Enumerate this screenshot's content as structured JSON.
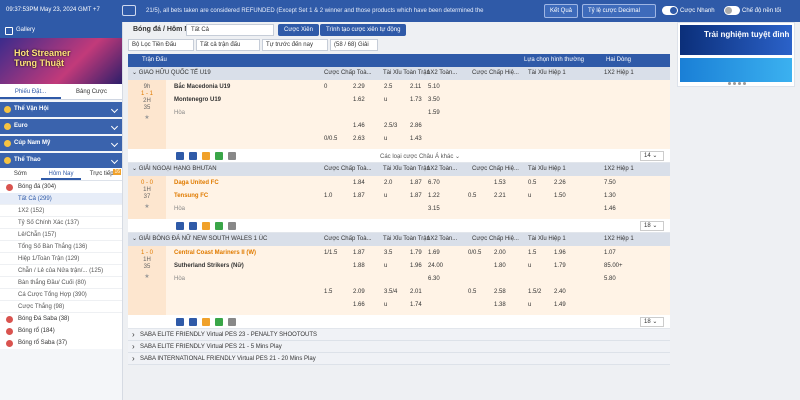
{
  "topbar": {
    "time": "09:37:53PM May 23, 2024 GMT +7",
    "ticker": "21/5), all bets taken are considered REFUNDED (Except Set 1 & 2 winner and those products which have been determined the",
    "result_btn": "Kết Quả",
    "odds_type": "Tỷ lệ cược Decimal",
    "quick_bet": "Cược Nhanh",
    "odds_only": "Chế độ nền tối"
  },
  "sidebar": {
    "gallery": "Gallery",
    "banner_text": "Hot Streamer Tưng Thuật",
    "tabs": [
      "Phiếu Đặt...",
      "Bảng Cược"
    ],
    "categories": [
      "Thể Vận Hội",
      "Euro",
      "Cúp Nam Mỹ",
      "Thể Thao"
    ],
    "subtabs": [
      "Sớm",
      "Hôm Nay",
      "Trực tiếp"
    ],
    "live_count": "16",
    "sports": [
      {
        "label": "Bóng đá",
        "count": "(304)"
      },
      {
        "label": "Tất Cả",
        "count": "(299)"
      },
      {
        "label": "1X2",
        "count": "(152)"
      },
      {
        "label": "Tỷ Số Chính Xác",
        "count": "(137)"
      },
      {
        "label": "Lẻ/Chẵn",
        "count": "(157)"
      },
      {
        "label": "Tổng Số Bàn Thắng",
        "count": "(136)"
      },
      {
        "label": "Hiệp 1/Toàn Trận",
        "count": "(129)"
      },
      {
        "label": "Chẵn / Lẻ của Nửa trận/...",
        "count": "(125)"
      },
      {
        "label": "Bàn thắng Đầu/ Cuối",
        "count": "(80)"
      },
      {
        "label": "Cá Cược Tổng Hợp",
        "count": "(390)"
      },
      {
        "label": "Cược Thắng",
        "count": "(98)"
      },
      {
        "label": "Bóng Đá Saba",
        "count": "(38)"
      },
      {
        "label": "Bóng rổ",
        "count": "(184)"
      },
      {
        "label": "Bóng rổ Saba",
        "count": "(37)"
      }
    ]
  },
  "main": {
    "title": "Bóng đá / Hôm Nay",
    "select_all": "Tất Cả",
    "bet_btn": "Cược Xiên",
    "create_btn": "Trình tạo cược xiên tự động",
    "filters": [
      "Bộ Lọc Tiền Đấu",
      "Tất cả trận đấu",
      "Tự trước đến nay",
      "(58 / 68) Giải"
    ],
    "col_headers": [
      "Cược Chấp Toà...",
      "Tài Xỉu Toàn Trận",
      "1X2 Toàn...",
      "Cược Chấp Hiệ...",
      "Tài Xỉu Hiệp 1",
      "1X2 Hiệp 1"
    ],
    "top_header": {
      "label": "Trận Đấu",
      "sort": "Lựa chọn hình thường",
      "view": "Hai Dòng"
    },
    "leagues": [
      {
        "name": "GIAO HỮU QUỐC TẾ U19",
        "time": "9h",
        "score": "1 - 1",
        "period": "2H",
        "minute": "35",
        "home": "Bắc Macedonia U19",
        "away": "Montenegro U19",
        "draw": "Hòa",
        "rows": [
          [
            "0",
            "2.29",
            "2.5",
            "2.11",
            "5.10",
            "",
            "",
            "",
            "",
            "",
            ""
          ],
          [
            "",
            "1.62",
            "u",
            "1.73",
            "3.50",
            "",
            "",
            "",
            "",
            "",
            ""
          ],
          [
            "",
            "",
            "",
            "",
            "1.59",
            "",
            "",
            "",
            "",
            "",
            ""
          ],
          [
            "",
            "1.46",
            "2.5/3",
            "2.86",
            "",
            "",
            "",
            "",
            "",
            "",
            ""
          ],
          [
            "0/0.5",
            "2.63",
            "u",
            "1.43",
            "",
            "",
            "",
            "",
            "",
            "",
            ""
          ]
        ],
        "more": "Các loại cược Châu Á khác",
        "page": "14"
      },
      {
        "name": "GIẢI NGOẠI HẠNG BHUTAN",
        "score": "0 - 0",
        "period": "1H",
        "minute": "37",
        "home": "Daga United FC",
        "away": "Tensung FC",
        "draw": "Hòa",
        "rows": [
          [
            "",
            "1.84",
            "2.0",
            "1.87",
            "6.70",
            "",
            "1.53",
            "0.5",
            "2.26",
            "7.50"
          ],
          [
            "1.0",
            "1.87",
            "u",
            "1.87",
            "1.22",
            "0.5",
            "2.21",
            "u",
            "1.50",
            "1.30"
          ],
          [
            "",
            "",
            "",
            "",
            "3.15",
            "",
            "",
            "",
            "",
            "1.46"
          ]
        ],
        "page": "18"
      },
      {
        "name": "GIẢI BÓNG ĐÁ NỮ NEW SOUTH WALES 1 ÚC",
        "score": "1 - 0",
        "period": "1H",
        "minute": "35",
        "home": "Central Coast Mariners II (W)",
        "away": "Sutherland Strikers (Nữ)",
        "draw": "Hòa",
        "rows": [
          [
            "1/1.5",
            "1.87",
            "3.5",
            "1.79",
            "1.69",
            "0/0.5",
            "2.00",
            "1.5",
            "1.96",
            "1.07"
          ],
          [
            "",
            "1.88",
            "u",
            "1.96",
            "24.00",
            "",
            "1.80",
            "u",
            "1.79",
            "85.00+"
          ],
          [
            "",
            "",
            "",
            "",
            "6.30",
            "",
            "",
            "",
            "",
            "5.80"
          ],
          [
            "1.5",
            "2.09",
            "3.5/4",
            "2.01",
            "",
            "0.5",
            "2.58",
            "1.5/2",
            "2.40",
            ""
          ],
          [
            "",
            "1.66",
            "u",
            "1.74",
            "",
            "",
            "1.38",
            "u",
            "1.49",
            ""
          ]
        ],
        "page": "18"
      }
    ],
    "collapsed": [
      "SABA ELITE FRIENDLY Virtual PES 23 - PENALTY SHOOTOUTS",
      "SABA ELITE FRIENDLY Virtual PES 21 - 5 Mins Play",
      "SABA INTERNATIONAL FRIENDLY Virtual PES 21 - 20 Mins Play"
    ]
  },
  "right": {
    "promo": "Trải nghiệm tuyệt đỉnh"
  }
}
